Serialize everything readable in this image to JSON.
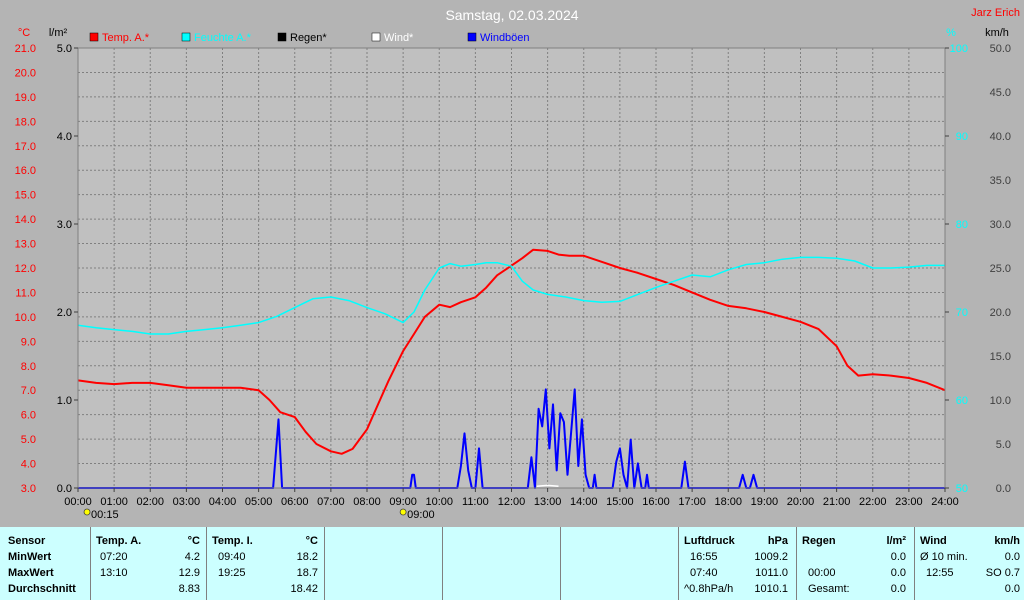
{
  "chart_data": {
    "type": "line",
    "title": "Samstag, 02.03.2024",
    "author": "Jarz Erich",
    "axes": {
      "temp": {
        "unit": "°C",
        "min": 3.0,
        "max": 21.0,
        "ticks": [
          "3.0",
          "4.0",
          "5.0",
          "6.0",
          "7.0",
          "8.0",
          "9.0",
          "10.0",
          "11.0",
          "12.0",
          "13.0",
          "14.0",
          "15.0",
          "16.0",
          "17.0",
          "18.0",
          "19.0",
          "20.0",
          "21.0"
        ]
      },
      "rain": {
        "unit": "l/m²",
        "min": 0,
        "max": 5.0,
        "ticks": [
          "0.0",
          "1.0",
          "2.0",
          "3.0",
          "4.0",
          "5.0"
        ]
      },
      "hum": {
        "unit": "%",
        "min": 50,
        "max": 100,
        "ticks": [
          "50",
          "60",
          "70",
          "80",
          "90",
          "100"
        ]
      },
      "wind": {
        "unit": "km/h",
        "min": 0,
        "max": 50.0,
        "ticks": [
          "0.0",
          "5.0",
          "10.0",
          "15.0",
          "20.0",
          "25.0",
          "30.0",
          "35.0",
          "40.0",
          "45.0",
          "50.0"
        ]
      }
    },
    "x_ticks": [
      "00:00",
      "01:00",
      "02:00",
      "03:00",
      "04:00",
      "05:00",
      "06:00",
      "07:00",
      "08:00",
      "09:00",
      "10:00",
      "11:00",
      "12:00",
      "13:00",
      "14:00",
      "15:00",
      "16:00",
      "17:00",
      "18:00",
      "19:00",
      "20:00",
      "21:00",
      "22:00",
      "23:00",
      "24:00"
    ],
    "markers": [
      {
        "label": "00:15",
        "x": 0.25
      },
      {
        "label": "09:00",
        "x": 9.0
      }
    ],
    "legend": [
      {
        "name": "Temp. A.*",
        "color": "#ff0000"
      },
      {
        "name": "Feuchte A.*",
        "color": "#00ffff"
      },
      {
        "name": "Regen*",
        "color": "#000000"
      },
      {
        "name": "Wind*",
        "color": "#ffffff"
      },
      {
        "name": "Windböen",
        "color": "#0000ff"
      }
    ],
    "grid": true,
    "series": [
      {
        "name": "Temp. A.*",
        "axis": "temp",
        "color": "#ff0000",
        "x": [
          0,
          0.5,
          1,
          1.5,
          2,
          2.5,
          3,
          3.5,
          4,
          4.5,
          5,
          5.3,
          5.6,
          6,
          6.3,
          6.6,
          7,
          7.3,
          7.6,
          8,
          8.3,
          8.6,
          9,
          9.3,
          9.6,
          10,
          10.3,
          10.6,
          11,
          11.3,
          11.6,
          12,
          12.3,
          12.6,
          13,
          13.3,
          13.6,
          14,
          14.3,
          14.6,
          15,
          15.5,
          16,
          16.5,
          17,
          17.5,
          18,
          18.5,
          19,
          19.5,
          20,
          20.5,
          21,
          21.3,
          21.6,
          22,
          22.5,
          23,
          23.5,
          24
        ],
        "y": [
          7.4,
          7.3,
          7.25,
          7.3,
          7.3,
          7.2,
          7.1,
          7.1,
          7.1,
          7.1,
          7.0,
          6.6,
          6.1,
          5.9,
          5.3,
          4.8,
          4.5,
          4.4,
          4.6,
          5.4,
          6.4,
          7.4,
          8.6,
          9.3,
          10.0,
          10.5,
          10.4,
          10.6,
          10.8,
          11.2,
          11.7,
          12.1,
          12.4,
          12.75,
          12.7,
          12.55,
          12.5,
          12.5,
          12.35,
          12.2,
          12.0,
          11.8,
          11.55,
          11.3,
          11.0,
          10.7,
          10.45,
          10.35,
          10.2,
          10.0,
          9.8,
          9.5,
          8.8,
          8.0,
          7.6,
          7.65,
          7.6,
          7.5,
          7.3,
          7.0
        ]
      },
      {
        "name": "Feuchte A.*",
        "axis": "hum",
        "color": "#00ffff",
        "x": [
          0,
          0.5,
          1,
          1.5,
          2,
          2.5,
          3,
          3.5,
          4,
          4.5,
          5,
          5.5,
          6,
          6.5,
          7,
          7.5,
          8,
          8.5,
          9,
          9.3,
          9.6,
          10,
          10.3,
          10.6,
          11,
          11.3,
          11.6,
          12,
          12.3,
          12.6,
          13,
          13.5,
          14,
          14.5,
          15,
          15.5,
          16,
          16.5,
          17,
          17.5,
          18,
          18.5,
          19,
          19.5,
          20,
          20.5,
          21,
          21.5,
          22,
          22.5,
          23,
          23.5,
          24
        ],
        "y": [
          68.5,
          68.2,
          68.0,
          67.8,
          67.5,
          67.5,
          67.8,
          68.0,
          68.2,
          68.5,
          68.8,
          69.5,
          70.5,
          71.5,
          71.7,
          71.3,
          70.5,
          69.8,
          68.8,
          70.0,
          72.5,
          75.0,
          75.5,
          75.2,
          75.4,
          75.6,
          75.6,
          75.2,
          73.5,
          72.5,
          72.0,
          71.7,
          71.3,
          71.1,
          71.2,
          72.0,
          72.8,
          73.5,
          74.2,
          74.0,
          74.8,
          75.4,
          75.6,
          76.0,
          76.2,
          76.2,
          76.1,
          75.8,
          75.0,
          75.0,
          75.1,
          75.3,
          75.3
        ]
      },
      {
        "name": "Windböen",
        "axis": "wind",
        "color": "#0000ff",
        "x": [
          0,
          5.4,
          5.55,
          5.65,
          5.8,
          8.8,
          9.2,
          9.25,
          9.3,
          9.35,
          9.5,
          10.5,
          10.6,
          10.7,
          10.8,
          10.9,
          11.0,
          11.1,
          11.2,
          11.3,
          11.4,
          12.4,
          12.45,
          12.55,
          12.65,
          12.75,
          12.85,
          12.95,
          13.05,
          13.15,
          13.25,
          13.35,
          13.45,
          13.55,
          13.65,
          13.75,
          13.85,
          13.95,
          14.05,
          14.15,
          14.2,
          14.25,
          14.3,
          14.35,
          14.45,
          14.5,
          14.6,
          14.7,
          14.8,
          14.9,
          15.0,
          15.1,
          15.2,
          15.3,
          15.4,
          15.5,
          15.6,
          15.7,
          15.75,
          15.8,
          16.3,
          16.7,
          16.8,
          16.9,
          17.0,
          17.1,
          17.4,
          18.2,
          18.3,
          18.4,
          18.5,
          18.6,
          18.7,
          18.8,
          18.9,
          19.0,
          19.1,
          19.2,
          24
        ],
        "y": [
          0,
          0,
          7.8,
          0,
          0,
          0,
          0,
          1.5,
          1.5,
          0,
          0,
          0,
          2.5,
          6.2,
          2.0,
          0,
          0,
          4.5,
          0,
          0,
          0,
          0,
          0,
          3.5,
          0,
          9.0,
          7.0,
          11.2,
          4.5,
          9.5,
          2.0,
          8.5,
          7.5,
          1.5,
          6.3,
          11.2,
          2.5,
          7.8,
          1.5,
          0,
          0,
          0,
          1.5,
          0,
          0,
          0,
          0,
          0,
          0,
          3.0,
          4.5,
          1.5,
          0,
          5.5,
          0,
          2.8,
          0,
          0,
          1.5,
          0,
          0,
          0,
          3.0,
          0,
          0,
          0,
          0,
          0,
          0,
          1.5,
          0,
          0,
          1.5,
          0,
          0,
          0,
          0,
          0,
          0
        ]
      },
      {
        "name": "Wind*",
        "axis": "wind",
        "color": "#ffffff",
        "x": [
          12.7,
          13.0,
          13.3
        ],
        "y": [
          0.2,
          0.3,
          0.2
        ]
      }
    ]
  },
  "table": {
    "sensor": {
      "header": "Sensor",
      "rows": [
        "MinWert",
        "MaxWert",
        "Durchschnitt"
      ]
    },
    "temp_a": {
      "header": "Temp. A.",
      "unit": "°C",
      "min_time": "07:20",
      "min_val": "4.2",
      "max_time": "13:10",
      "max_val": "12.9",
      "avg": "8.83"
    },
    "temp_i": {
      "header": "Temp. I.",
      "unit": "°C",
      "min_time": "09:40",
      "min_val": "18.2",
      "max_time": "19:25",
      "max_val": "18.7",
      "avg": "18.42"
    },
    "pressure": {
      "header": "Luftdruck",
      "unit": "hPa",
      "r1_time": "16:55",
      "r1_val": "1009.2",
      "r2_time": "07:40",
      "r2_val": "1011.0",
      "r3_time": "^0.8hPa/h",
      "r3_val": "1010.1"
    },
    "rain": {
      "header": "Regen",
      "unit": "l/m²",
      "r2_time": "00:00",
      "r2_val": "0.0",
      "r3_label": "Gesamt:",
      "r3_val": "0.0",
      "r1_val": "0.0"
    },
    "wind": {
      "header": "Wind",
      "unit": "km/h",
      "r1_label": "Ø 10 min.",
      "r1_val": "0.0",
      "r2_time": "12:55",
      "r2_val": "SO 0.7",
      "r3_val": "0.0"
    }
  }
}
